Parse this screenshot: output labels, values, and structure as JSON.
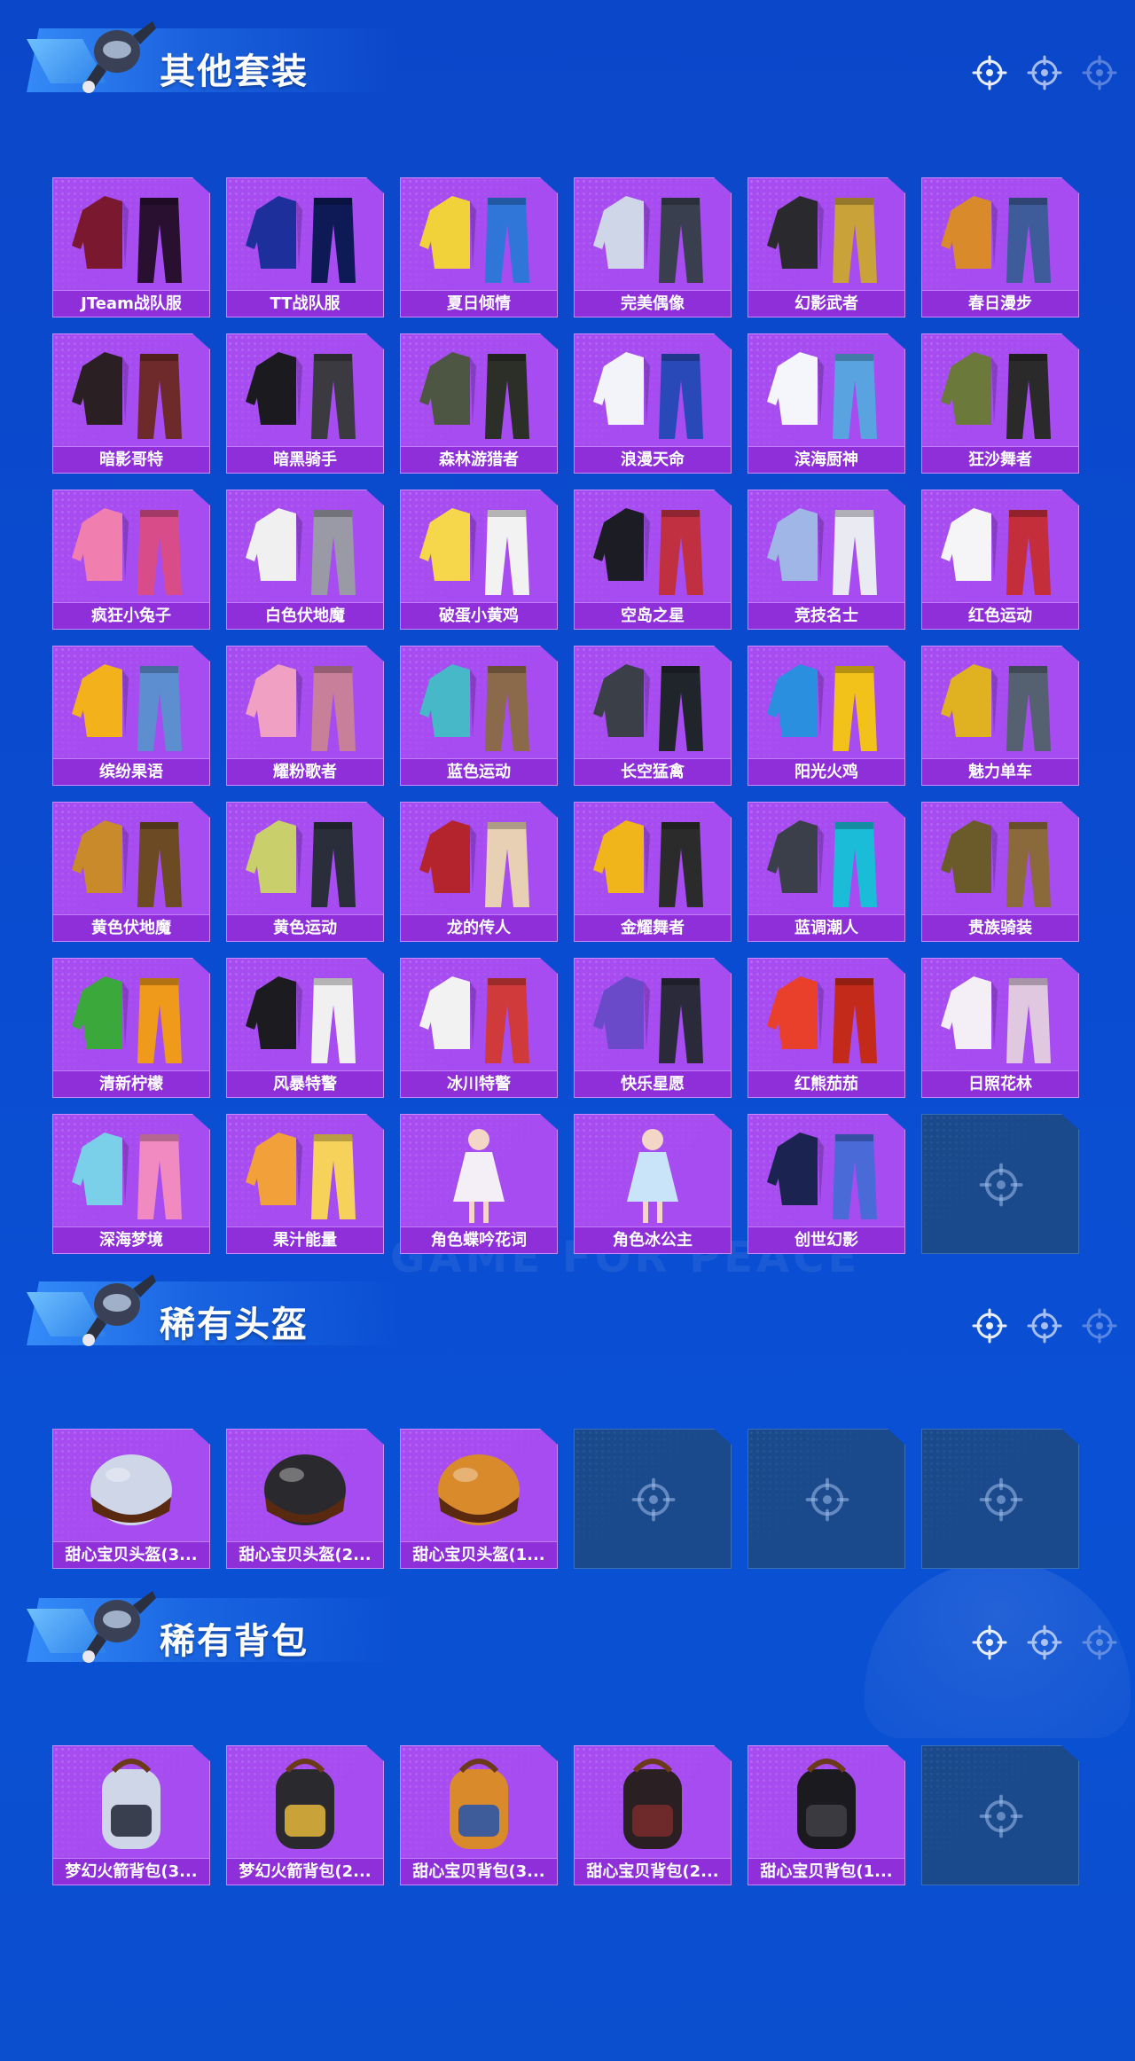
{
  "bg_watermark": "GAME FOR PEACE",
  "sections": [
    {
      "title": "其他套装",
      "items": [
        {
          "label": "JTeam战队服",
          "icon": "red-team-suit"
        },
        {
          "label": "TT战队服",
          "icon": "blue-team-suit"
        },
        {
          "label": "夏日倾情",
          "icon": "summer-outfit"
        },
        {
          "label": "完美偶像",
          "icon": "idol-outfit"
        },
        {
          "label": "幻影武者",
          "icon": "phantom-warrior-outfit"
        },
        {
          "label": "春日漫步",
          "icon": "spring-outfit"
        },
        {
          "label": "暗影哥特",
          "icon": "gothic-outfit"
        },
        {
          "label": "暗黑骑手",
          "icon": "dark-rider-outfit"
        },
        {
          "label": "森林游猎者",
          "icon": "forest-hunter-outfit"
        },
        {
          "label": "浪漫天命",
          "icon": "romance-outfit"
        },
        {
          "label": "滨海厨神",
          "icon": "chef-outfit"
        },
        {
          "label": "狂沙舞者",
          "icon": "sand-dancer-outfit"
        },
        {
          "label": "疯狂小兔子",
          "icon": "bunny-outfit"
        },
        {
          "label": "白色伏地魔",
          "icon": "white-hoodie-outfit"
        },
        {
          "label": "破蛋小黄鸡",
          "icon": "chick-outfit"
        },
        {
          "label": "空岛之星",
          "icon": "sky-star-outfit"
        },
        {
          "label": "竞技名士",
          "icon": "sport-jacket-outfit"
        },
        {
          "label": "红色运动",
          "icon": "red-sport-outfit"
        },
        {
          "label": "缤纷果语",
          "icon": "fruit-outfit"
        },
        {
          "label": "耀粉歌者",
          "icon": "pink-singer-outfit"
        },
        {
          "label": "蓝色运动",
          "icon": "blue-sport-outfit"
        },
        {
          "label": "长空猛禽",
          "icon": "camo-outfit"
        },
        {
          "label": "阳光火鸡",
          "icon": "sunny-outfit"
        },
        {
          "label": "魅力单车",
          "icon": "bike-outfit"
        },
        {
          "label": "黄色伏地魔",
          "icon": "yellow-hoodie-outfit"
        },
        {
          "label": "黄色运动",
          "icon": "yellow-sport-outfit"
        },
        {
          "label": "龙的传人",
          "icon": "dragon-outfit"
        },
        {
          "label": "金耀舞者",
          "icon": "gold-dancer-outfit"
        },
        {
          "label": "蓝调潮人",
          "icon": "blues-outfit"
        },
        {
          "label": "贵族骑装",
          "icon": "noble-outfit"
        },
        {
          "label": "清新柠檬",
          "icon": "lemon-outfit"
        },
        {
          "label": "风暴特警",
          "icon": "storm-swat-outfit"
        },
        {
          "label": "冰川特警",
          "icon": "glacier-swat-outfit"
        },
        {
          "label": "快乐星愿",
          "icon": "star-wish-outfit"
        },
        {
          "label": "红熊茄茄",
          "icon": "red-bear-outfit"
        },
        {
          "label": "日照花林",
          "icon": "white-dress-outfit"
        },
        {
          "label": "深海梦境",
          "icon": "shark-outfit"
        },
        {
          "label": "果汁能量",
          "icon": "juice-outfit"
        },
        {
          "label": "角色蝶吟花词",
          "icon": "character-butterfly"
        },
        {
          "label": "角色冰公主",
          "icon": "character-ice-princess"
        },
        {
          "label": "创世幻影",
          "icon": "genesis-outfit"
        },
        {
          "label": null,
          "icon": "empty-slot-icon"
        }
      ]
    },
    {
      "title": "稀有头盔",
      "items": [
        {
          "label": "甜心宝贝头盔(3...",
          "icon": "cupcake-helmet-yellow"
        },
        {
          "label": "甜心宝贝头盔(2...",
          "icon": "cupcake-helmet-brown"
        },
        {
          "label": "甜心宝贝头盔(1...",
          "icon": "helmet-red"
        },
        {
          "label": null,
          "icon": "empty-slot-icon"
        },
        {
          "label": null,
          "icon": "empty-slot-icon"
        },
        {
          "label": null,
          "icon": "empty-slot-icon"
        }
      ]
    },
    {
      "title": "稀有背包",
      "items": [
        {
          "label": "梦幻火箭背包(3...",
          "icon": "rocket-backpack"
        },
        {
          "label": "梦幻火箭背包(2...",
          "icon": "rocket-backpack-2"
        },
        {
          "label": "甜心宝贝背包(3...",
          "icon": "cake-backpack-3"
        },
        {
          "label": "甜心宝贝背包(2...",
          "icon": "cake-backpack-2"
        },
        {
          "label": "甜心宝贝背包(1...",
          "icon": "cake-backpack-1"
        },
        {
          "label": null,
          "icon": "empty-slot-icon"
        }
      ]
    }
  ],
  "colors": {
    "background": "#0b47c9",
    "card": "#a64cf0",
    "card_label": "#8f2fd9",
    "empty_card": "#1b4a8c"
  }
}
